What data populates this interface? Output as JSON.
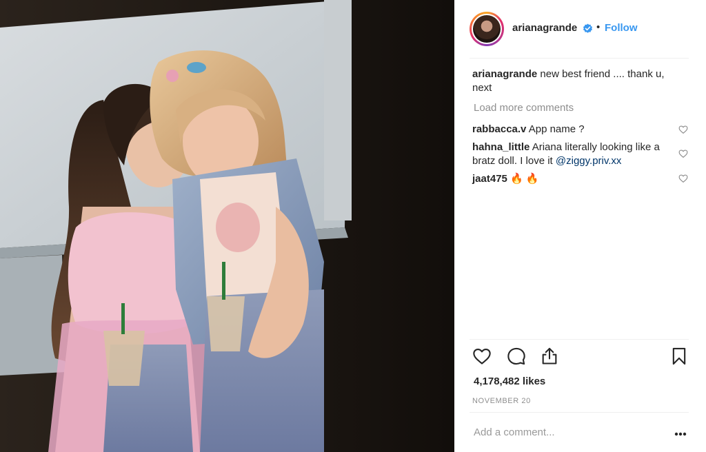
{
  "post": {
    "username": "arianagrande",
    "verified": true,
    "separator": "•",
    "follow_label": "Follow",
    "caption": {
      "user": "arianagrande",
      "text": "new best friend .... thank u, next"
    },
    "load_more_label": "Load more comments",
    "comments": [
      {
        "user": "rabbacca.v",
        "text": "App name ?",
        "mention": ""
      },
      {
        "user": "hahna_little",
        "text": "Ariana literally looking like a bratz doll. I love it",
        "mention": "@ziggy.priv.xx"
      },
      {
        "user": "jaat475",
        "text": "🔥 🔥",
        "mention": ""
      }
    ],
    "likes": "4,178,482 likes",
    "date": "NOVEMBER 20",
    "add_comment_placeholder": "Add a comment..."
  },
  "colors": {
    "follow_blue": "#3897f0",
    "mention_blue": "#003569",
    "muted_gray": "#8e8e8e",
    "verified_blue": "#3897f0"
  },
  "icons": [
    "verified-badge-icon",
    "heart-icon",
    "comment-icon",
    "share-icon",
    "bookmark-icon",
    "more-options-icon"
  ]
}
